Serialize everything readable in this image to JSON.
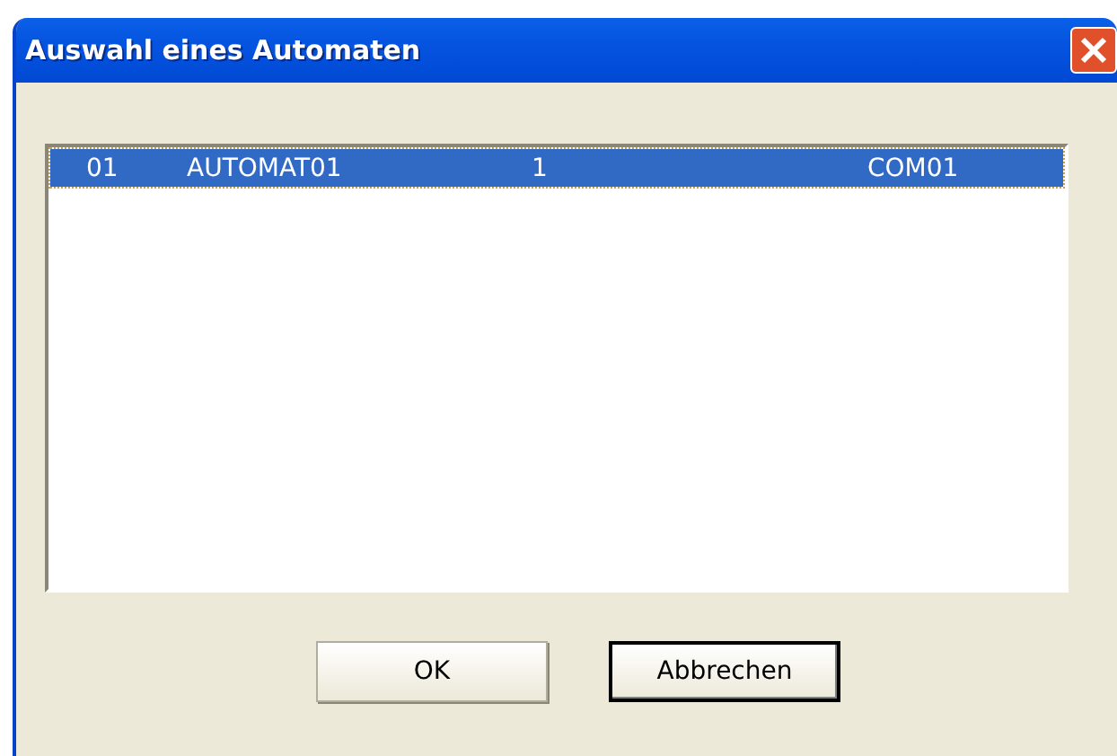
{
  "window": {
    "title": "Auswahl eines Automaten"
  },
  "list": {
    "rows": [
      {
        "cells": [
          "01",
          "AUTOMAT01",
          "1",
          "COM01"
        ],
        "selected": true
      }
    ]
  },
  "buttons": [
    {
      "label": "OK",
      "default": false
    },
    {
      "label": "Abbrechen",
      "default": true
    }
  ]
}
